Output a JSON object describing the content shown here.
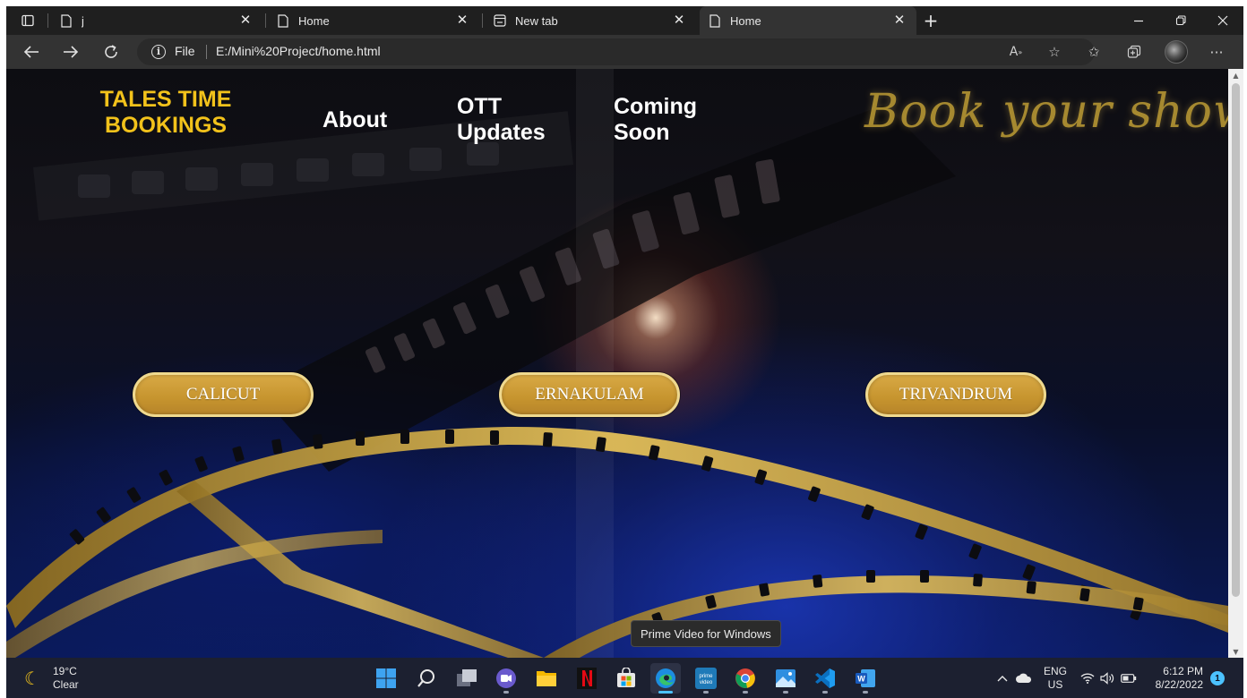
{
  "browser": {
    "tabs": [
      {
        "label": "j",
        "icon": "page-icon"
      },
      {
        "label": "Home",
        "icon": "page-icon"
      },
      {
        "label": "New tab",
        "icon": "newtab-icon"
      },
      {
        "label": "Home",
        "icon": "page-icon",
        "active": true
      }
    ],
    "new_tab": "+",
    "address": {
      "scheme": "File",
      "url": "E:/Mini%20Project/home.html"
    }
  },
  "page": {
    "brand_line1": "TALES TIME",
    "brand_line2": "BOOKINGS",
    "nav": {
      "about": "About",
      "ott_line1": "OTT",
      "ott_line2": "Updates",
      "coming_line1": "Coming",
      "coming_line2": "Soon"
    },
    "tagline": "Book your show..",
    "cities": [
      "CALICUT",
      "ERNAKULAM",
      "TRIVANDRUM"
    ],
    "colors": {
      "brand": "#f2c21b",
      "button": "#c9992f",
      "button_border": "#efd98f"
    }
  },
  "tooltip": "Prime Video for Windows",
  "taskbar": {
    "weather_temp": "19°C",
    "weather_cond": "Clear",
    "apps": [
      "windows-start",
      "search",
      "task-view",
      "chat",
      "file-explorer",
      "netflix",
      "microsoft-store",
      "edge",
      "prime-video",
      "chrome",
      "photos",
      "vscode",
      "word"
    ],
    "lang_line1": "ENG",
    "lang_line2": "US",
    "time": "6:12 PM",
    "date": "8/22/2022",
    "notifications": "1"
  }
}
